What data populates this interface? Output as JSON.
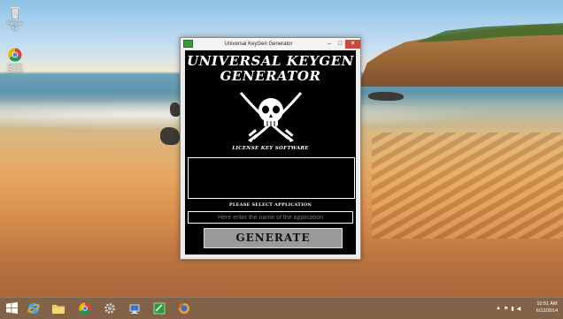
{
  "desktop": {
    "icons": [
      {
        "label": "Recycle Bin",
        "icon": "recycle-bin-icon"
      },
      {
        "label": "Google Chrome",
        "icon": "chrome-icon"
      }
    ]
  },
  "window": {
    "title": "Universal KeyGen Generator",
    "controls": {
      "minimize": "–",
      "maximize": "□",
      "close": "✕"
    },
    "heading": "UNIVERSAL KEYGEN GENERATOR",
    "subtitle": "LICENSE KEY SOFTWARE",
    "select_label": "PLEASE SELECT APPLICATION",
    "app_input_placeholder": "Here enter the name of the application",
    "generate_label": "GENERATE"
  },
  "taskbar": {
    "pinned": [
      "start-icon",
      "internet-explorer-icon",
      "file-explorer-icon",
      "chrome-icon",
      "settings-icon",
      "network-icon",
      "keygen-app-icon",
      "firefox-icon"
    ],
    "clock_time": "10:51 AM",
    "clock_date": "6/12/2014"
  },
  "colors": {
    "taskbar": "#7a5838",
    "window_bg": "#000000",
    "generate_button": "#9a9a9a"
  }
}
